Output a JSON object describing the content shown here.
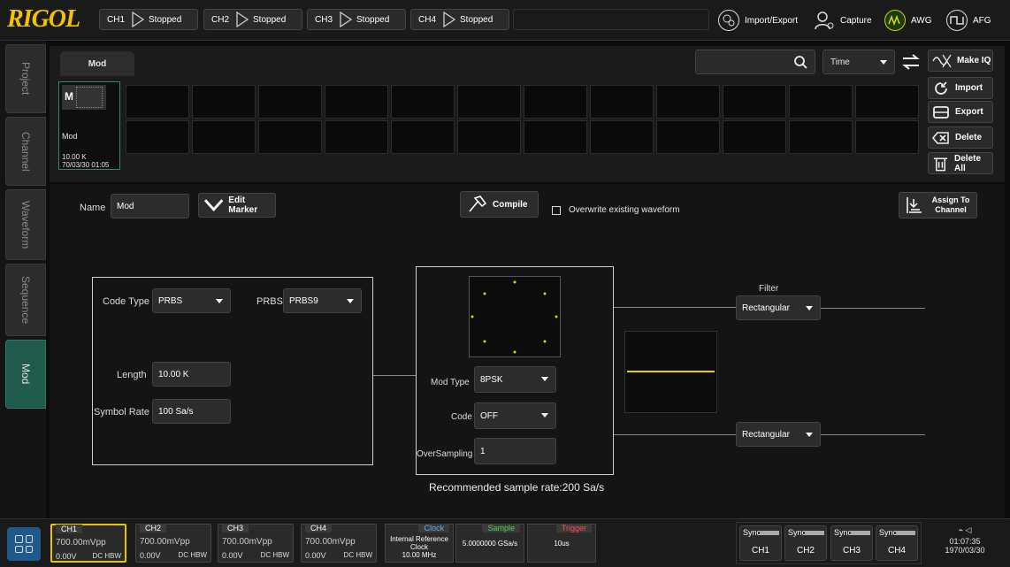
{
  "header": {
    "logo": "RIGOL",
    "channels": [
      {
        "name": "CH1",
        "status": "Stopped"
      },
      {
        "name": "CH2",
        "status": "Stopped"
      },
      {
        "name": "CH3",
        "status": "Stopped"
      },
      {
        "name": "CH4",
        "status": "Stopped"
      }
    ],
    "import_export": "Import/Export",
    "capture": "Capture",
    "awg": "AWG",
    "afg": "AFG"
  },
  "sidebar": {
    "tabs": [
      "Project",
      "Channel",
      "Waveform",
      "Sequence",
      "Mod"
    ],
    "active": "Mod"
  },
  "library": {
    "tab": "Mod",
    "sort": "Time",
    "item": {
      "badge": "M",
      "name": "Mod",
      "size": "10.00 K",
      "date": "70/03/30 01:05"
    },
    "buttons": [
      "Make IQ",
      "Import",
      "Export",
      "Delete",
      "Delete All"
    ]
  },
  "editor": {
    "name_label": "Name",
    "name_value": "Mod",
    "edit_marker": "Edit Marker",
    "compile": "Compile",
    "overwrite": "Overwrite existing waveform",
    "assign": [
      "Assign To",
      "Channel"
    ],
    "code_type_label": "Code Type",
    "code_type": "PRBS",
    "prbs_label": "PRBS",
    "prbs": "PRBS9",
    "length_label": "Length",
    "length": "10.00 K",
    "symbol_rate_label": "Symbol Rate",
    "symbol_rate": "100 Sa/s",
    "mod_type_label": "Mod Type",
    "mod_type": "8PSK",
    "code_label": "Code",
    "code": "OFF",
    "oversampling_label": "OverSampling",
    "oversampling": "1",
    "filter_label": "Filter",
    "filter_i": "Rectangular",
    "filter_q": "Rectangular",
    "recommended": "Recommended sample rate:200 Sa/s"
  },
  "footer": {
    "channels": [
      {
        "name": "CH1",
        "vpp": "700.00mVpp",
        "offset": "0.00V",
        "coupling": "DC HBW"
      },
      {
        "name": "CH2",
        "vpp": "700.00mVpp",
        "offset": "0.00V",
        "coupling": "DC HBW"
      },
      {
        "name": "CH3",
        "vpp": "700.00mVpp",
        "offset": "0.00V",
        "coupling": "DC HBW"
      },
      {
        "name": "CH4",
        "vpp": "700.00mVpp",
        "offset": "0.00V",
        "coupling": "DC HBW"
      }
    ],
    "clock": {
      "title": "Clock",
      "l1": "Internal Reference",
      "l2": "Clock",
      "l3": "10.00 MHz"
    },
    "sample": {
      "title": "Sample",
      "value": "5.0000000 GSa/s"
    },
    "trigger": {
      "title": "Trigger",
      "value": "10us"
    },
    "sync": [
      {
        "label": "Sync",
        "ch": "CH1"
      },
      {
        "label": "Sync",
        "ch": "CH2"
      },
      {
        "label": "Sync",
        "ch": "CH3"
      },
      {
        "label": "Sync",
        "ch": "CH4"
      }
    ],
    "time": "01:07:35",
    "date": "1970/03/30"
  },
  "colors": {
    "accent": "#f2c200",
    "active_tab": "#1f5a4c",
    "clock_title": "#6aa8ff",
    "sample_title": "#4fd15a",
    "trigger_title": "#ff4a4a"
  }
}
